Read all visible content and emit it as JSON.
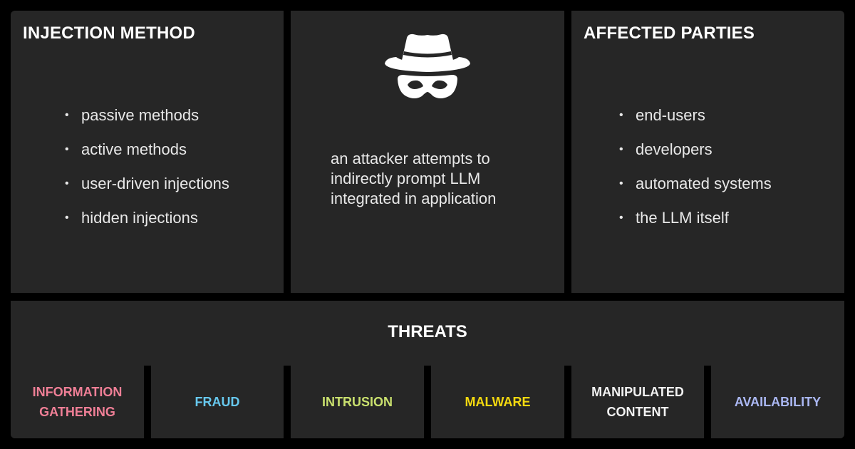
{
  "injection_method": {
    "title": "INJECTION METHOD",
    "items": [
      {
        "bullet": "•",
        "label": "passive methods"
      },
      {
        "bullet": "•",
        "label": "active methods"
      },
      {
        "bullet": "•",
        "label": "user-driven injections"
      },
      {
        "bullet": "•",
        "label": "hidden injections"
      }
    ]
  },
  "attacker": {
    "icon": "spy-incognito-icon",
    "description_lines": [
      "an attacker attempts to",
      "indirectly prompt LLM",
      "integrated in application"
    ]
  },
  "affected_parties": {
    "title": "AFFECTED PARTIES",
    "items": [
      {
        "bullet": "•",
        "label": "end-users"
      },
      {
        "bullet": "•",
        "label": "developers"
      },
      {
        "bullet": "•",
        "label": "automated systems"
      },
      {
        "bullet": "•",
        "label": "the LLM itself"
      }
    ]
  },
  "threats": {
    "title": "THREATS",
    "items": [
      {
        "line1": "INFORMATION",
        "line2": "GATHERING",
        "color": "#ef7f96"
      },
      {
        "line1": "FRAUD",
        "line2": "",
        "color": "#67c8ee"
      },
      {
        "line1": "INTRUSION",
        "line2": "",
        "color": "#c9e06e"
      },
      {
        "line1": "MALWARE",
        "line2": "",
        "color": "#f4d90f"
      },
      {
        "line1": "MANIPULATED",
        "line2": "CONTENT",
        "color": "#f2f2f2"
      },
      {
        "line1": "AVAILABILITY",
        "line2": "",
        "color": "#aab7f2"
      }
    ]
  }
}
